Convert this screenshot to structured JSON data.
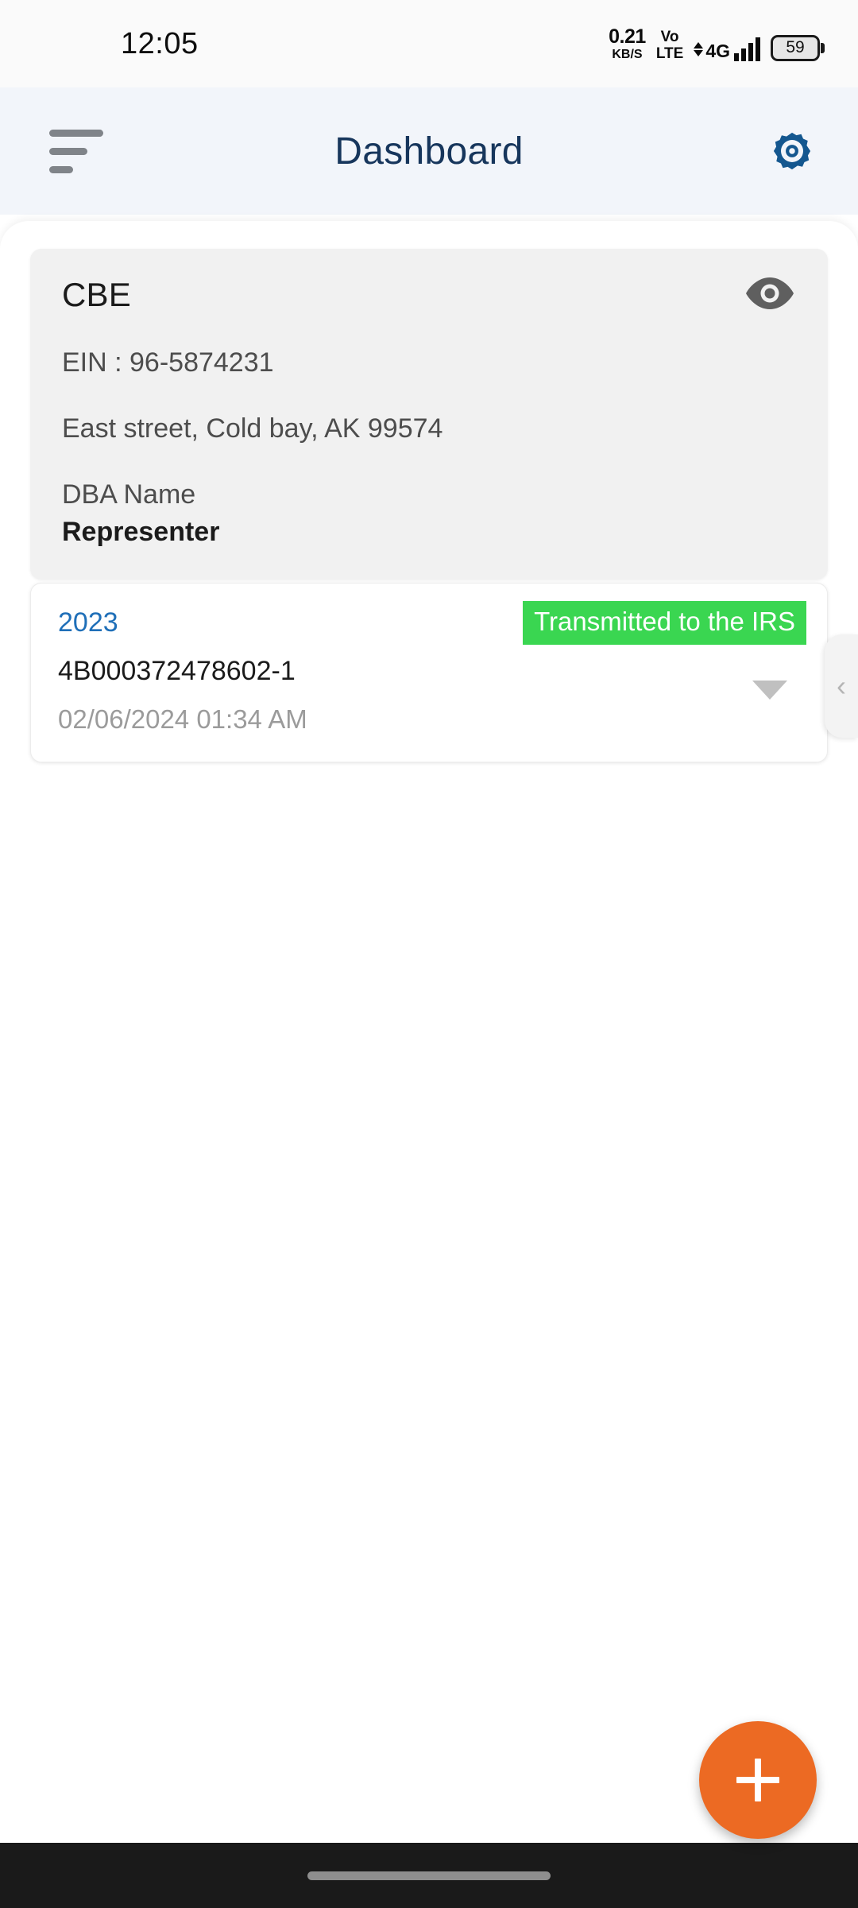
{
  "status_bar": {
    "time": "12:05",
    "net_speed_value": "0.21",
    "net_speed_unit": "KB/S",
    "volte_line1": "Vo",
    "volte_line2": "LTE",
    "network_type": "4G",
    "battery_level": "59"
  },
  "app_bar": {
    "title": "Dashboard",
    "menu_icon": "hamburger-menu-icon",
    "settings_icon": "gear-icon",
    "title_color": "#17365c",
    "settings_color": "#14578f",
    "background_color": "#f2f5fa"
  },
  "company_card": {
    "name": "CBE",
    "ein": "EIN : 96-5874231",
    "address": "East street, Cold bay, AK 99574",
    "dba_label": "DBA Name",
    "dba_value": "Representer",
    "visibility_icon": "eye-icon",
    "background_color": "#f1f1f1"
  },
  "drawer_handle": {
    "icon": "chevron-left-icon",
    "glyph": "‹"
  },
  "filings": [
    {
      "year": "2023",
      "submission_id": "4B000372478602-1",
      "timestamp": "02/06/2024 01:34 AM",
      "status": "Transmitted to the IRS",
      "status_color": "#3ad651",
      "expand_icon": "caret-down-icon"
    }
  ],
  "fab": {
    "icon": "plus-icon",
    "label": "+",
    "color": "#ec6a23"
  },
  "nav_bar": {
    "gesture_pill": "home-gesture-pill"
  }
}
